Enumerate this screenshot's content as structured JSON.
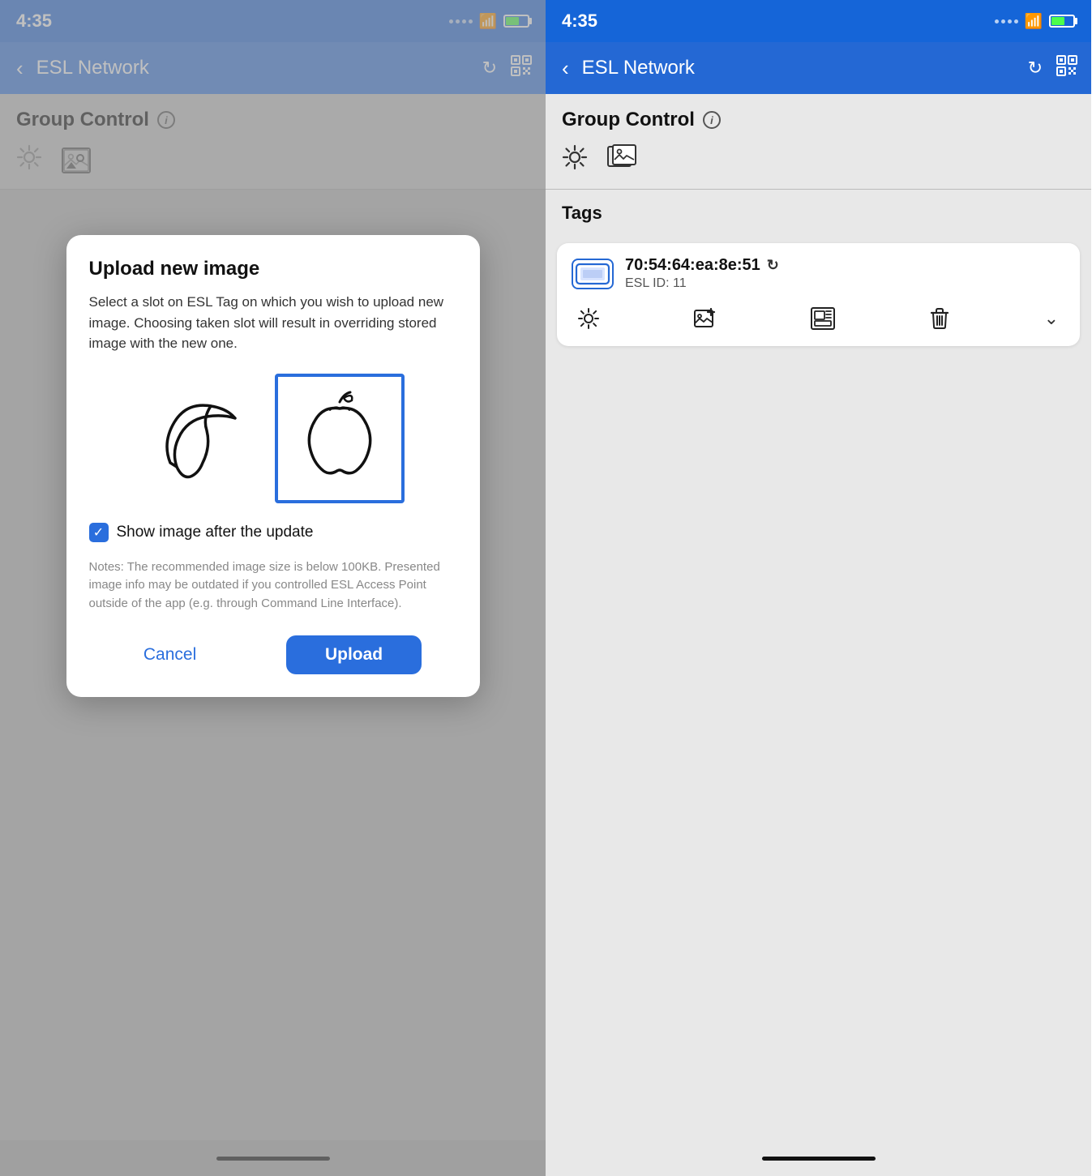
{
  "left_panel": {
    "status": {
      "time": "4:35"
    },
    "nav": {
      "title": "ESL Network",
      "back_label": "‹"
    },
    "group_control": {
      "title": "Group Control"
    },
    "modal": {
      "title": "Upload new image",
      "description": "Select a slot on ESL Tag on which you wish to upload new image. Choosing taken slot will result in overriding stored image with the new one.",
      "checkbox_label": "Show image after the update",
      "notes": "Notes: The recommended image size is below 100KB. Presented image info may be outdated if you controlled ESL Access Point outside of the app (e.g. through Command Line Interface).",
      "cancel_label": "Cancel",
      "upload_label": "Upload"
    }
  },
  "right_panel": {
    "status": {
      "time": "4:35"
    },
    "nav": {
      "title": "ESL Network",
      "back_label": "‹"
    },
    "group_control": {
      "title": "Group Control"
    },
    "tags_section": {
      "label": "Tags"
    },
    "tag_card": {
      "mac_address": "70:54:64:ea:8e:51",
      "esl_id": "ESL ID: 11"
    }
  }
}
